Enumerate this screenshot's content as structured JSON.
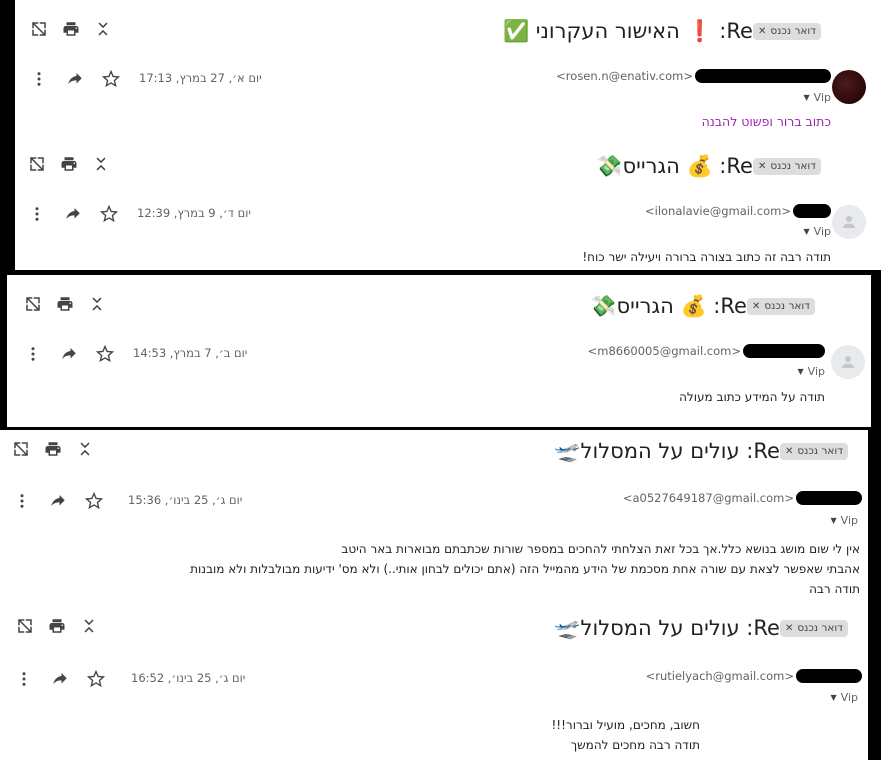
{
  "chip_label": "דואר נכנס",
  "vip_label": "Vip",
  "emails": [
    {
      "subject": "Re: ❗ האישור העקרוני ✅",
      "sender_email": "<rosen.n@enativ.com>",
      "date": "יום א׳, 27 במרץ, 17:13",
      "body_lines": [
        "כתוב ברור ופשוט להבנה"
      ]
    },
    {
      "subject": "Re: 💰 הגרייס💸",
      "sender_email": "<ilonalavie@gmail.com>",
      "date": "יום ד׳, 9 במרץ, 12:39",
      "body_lines": [
        "תודה רבה זה כתוב בצורה ברורה ויעילה ישר כוח!"
      ]
    },
    {
      "subject": "Re: 💰 הגרייס💸",
      "sender_email": "<m8660005@gmail.com>",
      "date": "יום ב׳, 7 במרץ, 14:53",
      "body_lines": [
        "תודה על המידע כתוב מעולה"
      ]
    },
    {
      "subject": "Re: עולים על המסלול🛫",
      "sender_email": "<a0527649187@gmail.com>",
      "date": "יום ג׳, 25 בינו׳, 15:36",
      "body_lines": [
        "אין לי שום מושג בנושא כלל.אך בכל זאת הצלחתי להחכים במספר שורות שכתבתם מבוארות באר היטב",
        "אהבתי שאפשר לצאת עם שורה אחת מסכמת של הידע מהמייל הזה (אתם יכולים לבחון אותי..) ולא מס' ידיעות מבולבלות ולא מובנות",
        "תודה רבה"
      ]
    },
    {
      "subject": "Re: עולים על המסלול🛫",
      "sender_email": "<rutielyach@gmail.com>",
      "date": "יום ג׳, 25 בינו׳, 16:52",
      "body_lines": [
        "חשוב, מחכים, מועיל וברור!!!",
        "תודה רבה מחכים להמשך"
      ]
    }
  ]
}
